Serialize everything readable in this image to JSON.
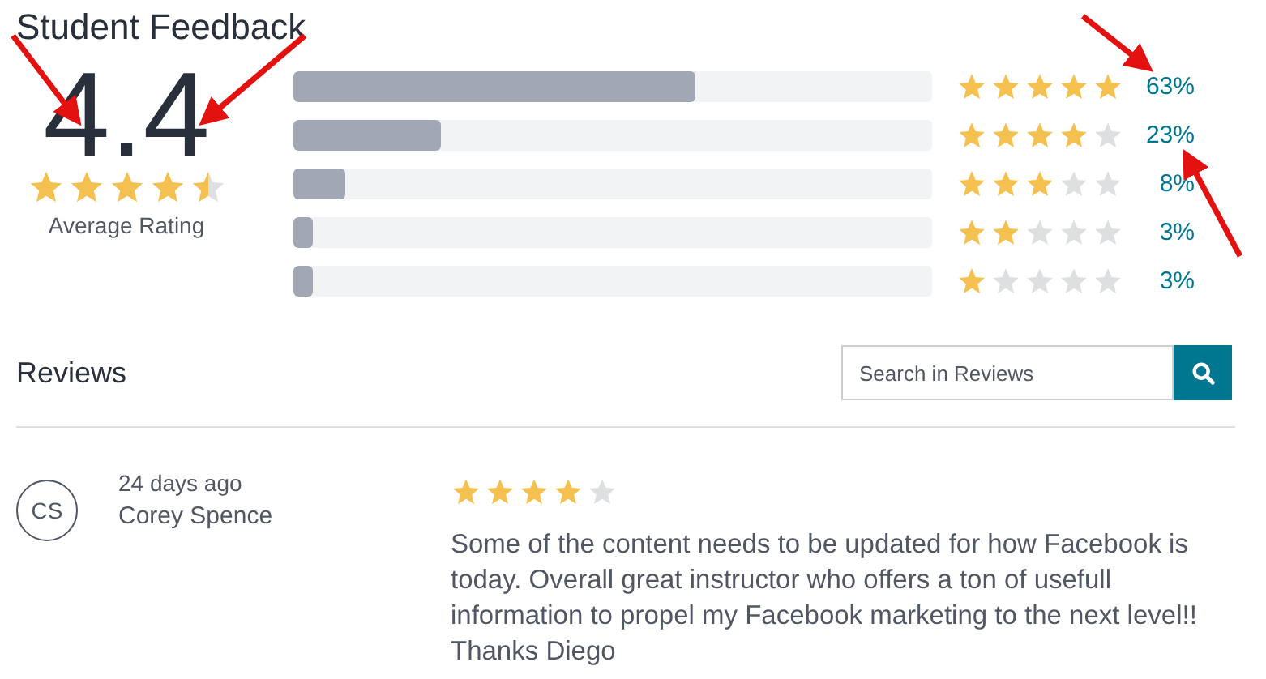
{
  "title": "Student Feedback",
  "average": {
    "value": "4.4",
    "stars": 4.5,
    "label": "Average Rating"
  },
  "breakdown": [
    {
      "level": 0.63,
      "stars": 5,
      "percent": "63%"
    },
    {
      "level": 0.23,
      "stars": 4,
      "percent": "23%"
    },
    {
      "level": 0.08,
      "stars": 3,
      "percent": "8%"
    },
    {
      "level": 0.03,
      "stars": 2,
      "percent": "3%"
    },
    {
      "level": 0.03,
      "stars": 1,
      "percent": "3%"
    }
  ],
  "reviews_heading": "Reviews",
  "search": {
    "placeholder": "Search in Reviews"
  },
  "reviews": [
    {
      "initials": "CS",
      "time": "24 days ago",
      "author": "Corey Spence",
      "stars": 4,
      "text": "Some of the content needs to be updated for how Facebook is today. Overall great instructor who offers a ton of usefull information to propel my Facebook marketing to the next level!! Thanks Diego"
    }
  ]
}
